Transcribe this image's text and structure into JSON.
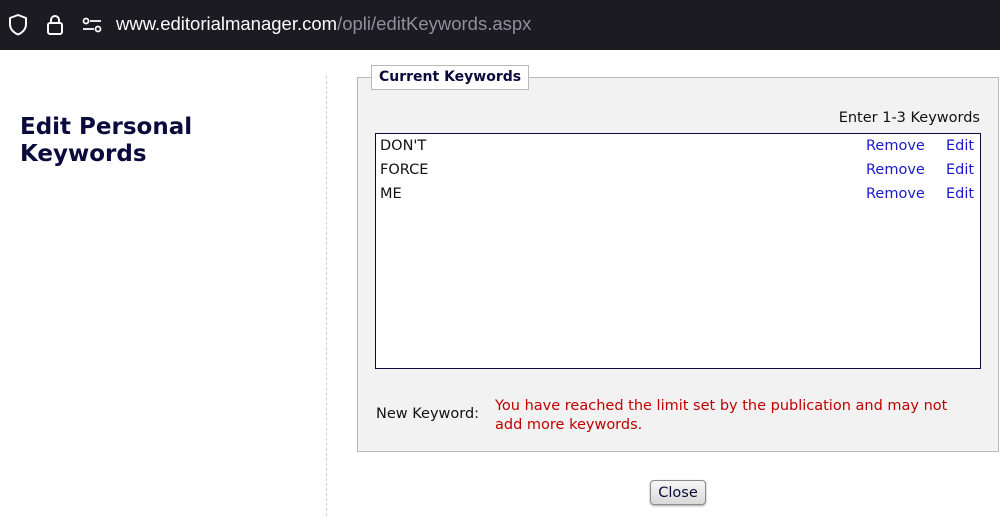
{
  "browser": {
    "url_domain": "www.editorialmanager.com",
    "url_path": "/opli/editKeywords.aspx",
    "icons": [
      "shield-icon",
      "lock-icon",
      "page-permissions-icon"
    ]
  },
  "page": {
    "title": "Edit Personal Keywords"
  },
  "panel": {
    "legend": "Current Keywords",
    "hint": "Enter 1-3 Keywords",
    "keywords": [
      {
        "text": "DON'T",
        "remove_label": "Remove",
        "edit_label": "Edit"
      },
      {
        "text": "FORCE",
        "remove_label": "Remove",
        "edit_label": "Edit"
      },
      {
        "text": "ME",
        "remove_label": "Remove",
        "edit_label": "Edit"
      }
    ],
    "new_keyword_label": "New Keyword:",
    "limit_message": "You have reached the limit set by the publication and may not add more keywords."
  },
  "actions": {
    "close_label": "Close"
  },
  "colors": {
    "link": "#1a1acc",
    "error": "#c00000",
    "heading": "#0a0a3c"
  }
}
